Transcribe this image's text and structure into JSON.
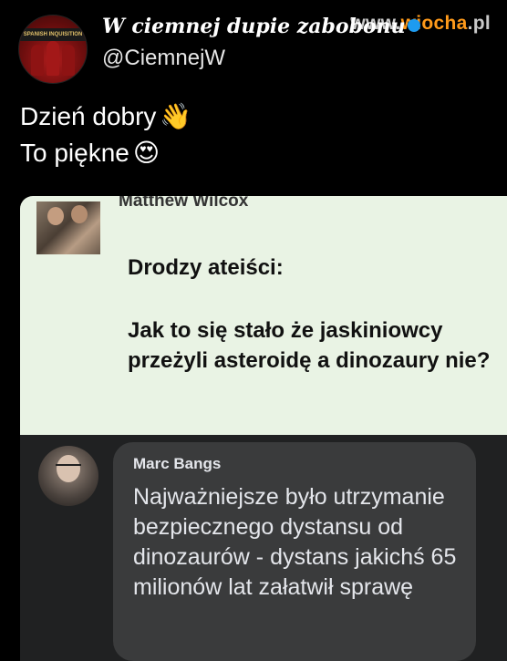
{
  "watermark": {
    "prefix": "www.",
    "brand": "wiocha",
    "suffix": ".pl"
  },
  "tweet": {
    "avatar_text": "SPANISH INQUISITION",
    "display_name": "W ciemnej dupie zabobonu",
    "handle": "@CiemnejW",
    "line1": "Dzień dobry",
    "line1_emoji": "👋",
    "line2": "To piękne",
    "line2_emoji": "😍",
    "verified_icon": "verified-badge-icon"
  },
  "quoted_post": {
    "author": "Matthew Wilcox",
    "greeting": "Drodzy ateiści:",
    "question": "Jak to się stało że jaskiniowcy przeżyli asteroidę a dinozaury nie?"
  },
  "reply": {
    "author": "Marc Bangs",
    "text": "Najważniejsze było utrzymanie bezpiecznego dystansu od dinozaurów - dystans jakichś 65 milionów lat załatwił sprawę"
  },
  "colors": {
    "background": "#000000",
    "card": "#e9f3e4",
    "bubble": "#3a3b3c",
    "watermark_accent": "#ff9a1a",
    "verified": "#1d9bf0"
  }
}
